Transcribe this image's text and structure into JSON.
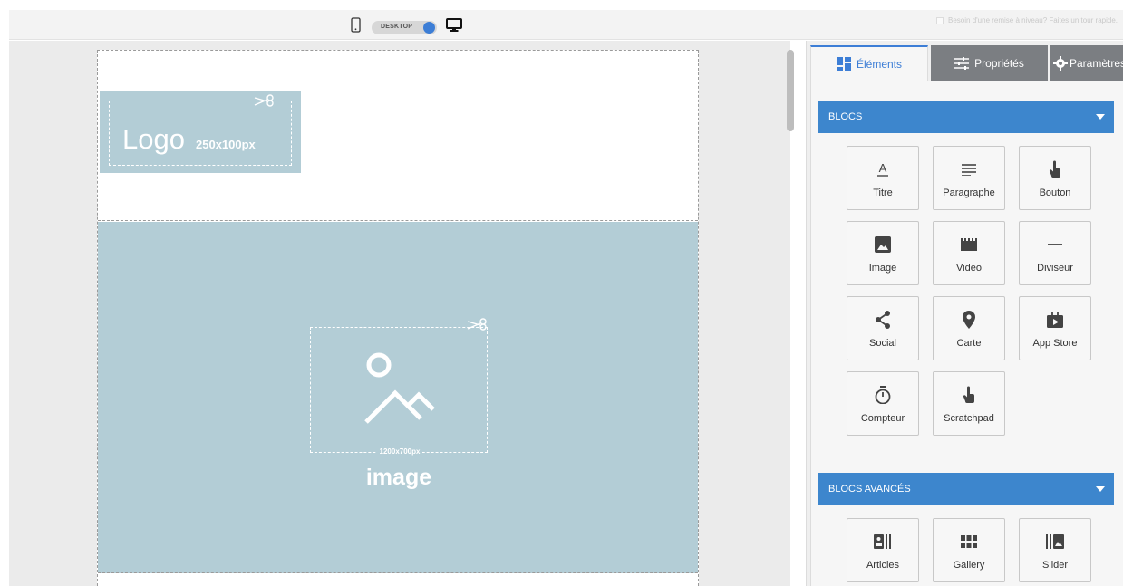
{
  "topbar": {
    "mode_label": "DESKTOP",
    "tour_text": "Besoin d'une remise à niveau? Faites un tour rapide."
  },
  "canvas": {
    "logo_text": "Logo",
    "logo_size": "250x100px",
    "hero_size": "1200x700px",
    "hero_label": "image"
  },
  "panel": {
    "tabs": [
      {
        "label": "Éléments",
        "icon": "grid-icon"
      },
      {
        "label": "Propriétés",
        "icon": "sliders-icon"
      },
      {
        "label": "Paramètres",
        "icon": "gear-icon"
      }
    ],
    "sections": [
      {
        "title": "BLOCS",
        "tiles": [
          {
            "label": "Titre",
            "icon": "title-icon"
          },
          {
            "label": "Paragraphe",
            "icon": "paragraph-icon"
          },
          {
            "label": "Bouton",
            "icon": "pointer-icon"
          },
          {
            "label": "Image",
            "icon": "image-icon"
          },
          {
            "label": "Video",
            "icon": "video-icon"
          },
          {
            "label": "Diviseur",
            "icon": "divider-icon"
          },
          {
            "label": "Social",
            "icon": "share-icon"
          },
          {
            "label": "Carte",
            "icon": "map-pin-icon"
          },
          {
            "label": "App Store",
            "icon": "app-store-icon"
          },
          {
            "label": "Compteur",
            "icon": "timer-icon"
          },
          {
            "label": "Scratchpad",
            "icon": "pointer-icon"
          }
        ]
      },
      {
        "title": "BLOCS AVANCÉS",
        "tiles": [
          {
            "label": "Articles",
            "icon": "articles-icon"
          },
          {
            "label": "Gallery",
            "icon": "gallery-icon"
          },
          {
            "label": "Slider",
            "icon": "slider-icon"
          }
        ]
      }
    ]
  },
  "colors": {
    "accent": "#3d86cd",
    "placeholder": "#b3cdd6",
    "tab_inactive": "#7b7e82"
  }
}
